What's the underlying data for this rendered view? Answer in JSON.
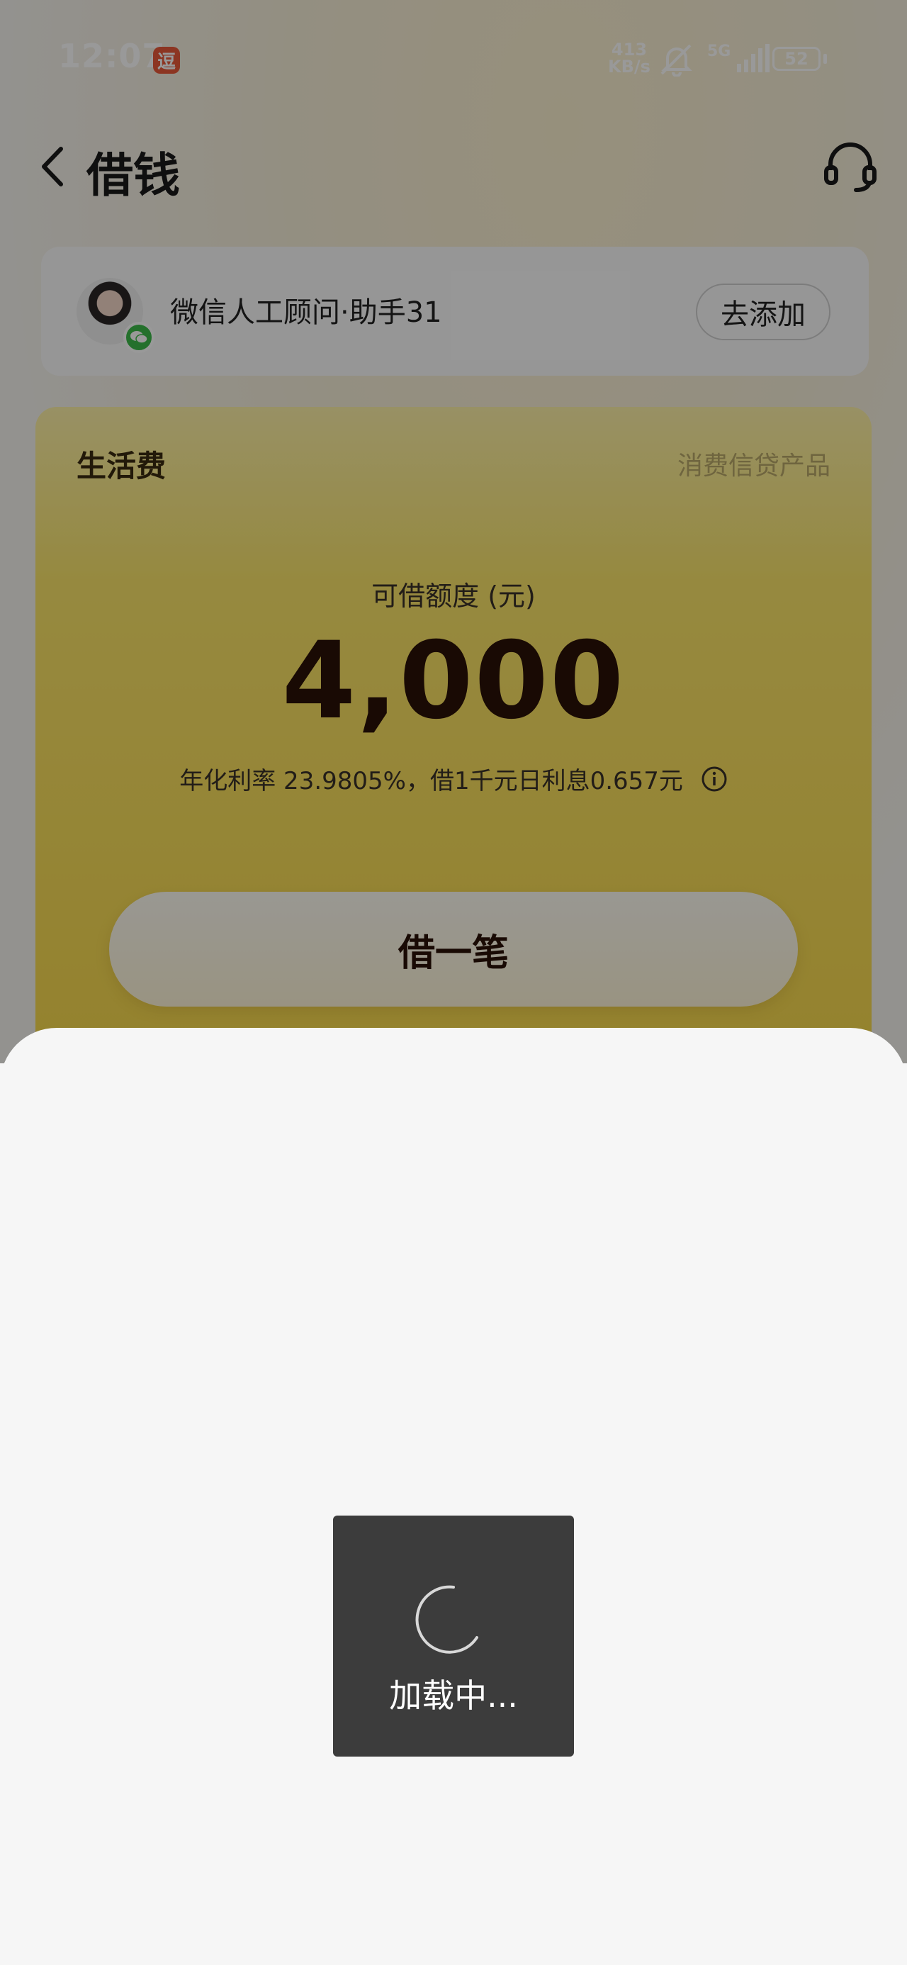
{
  "status_bar": {
    "time": "12:07",
    "app_badge": "逗",
    "net_speed_value": "413",
    "net_speed_unit": "KB/s",
    "network": "5G",
    "battery": "52"
  },
  "nav": {
    "title": "借钱",
    "back_icon": "chevron-left-icon",
    "support_icon": "headset-icon"
  },
  "advisor": {
    "name": "微信人工顾问·助手31",
    "add_label": "去添加"
  },
  "loan_card": {
    "product_name": "生活费",
    "product_type": "消费信贷产品",
    "limit_label": "可借额度 (元)",
    "limit_amount": "4,000",
    "rate_text": "年化利率  23.9805%，借1千元日利息0.657元",
    "borrow_label": "借一笔"
  },
  "loading": {
    "text": "加载中..."
  },
  "colors": {
    "card_yellow": "#f7d84a",
    "toast_bg": "#3c3c3c",
    "wechat_green": "#3dbb4a"
  }
}
